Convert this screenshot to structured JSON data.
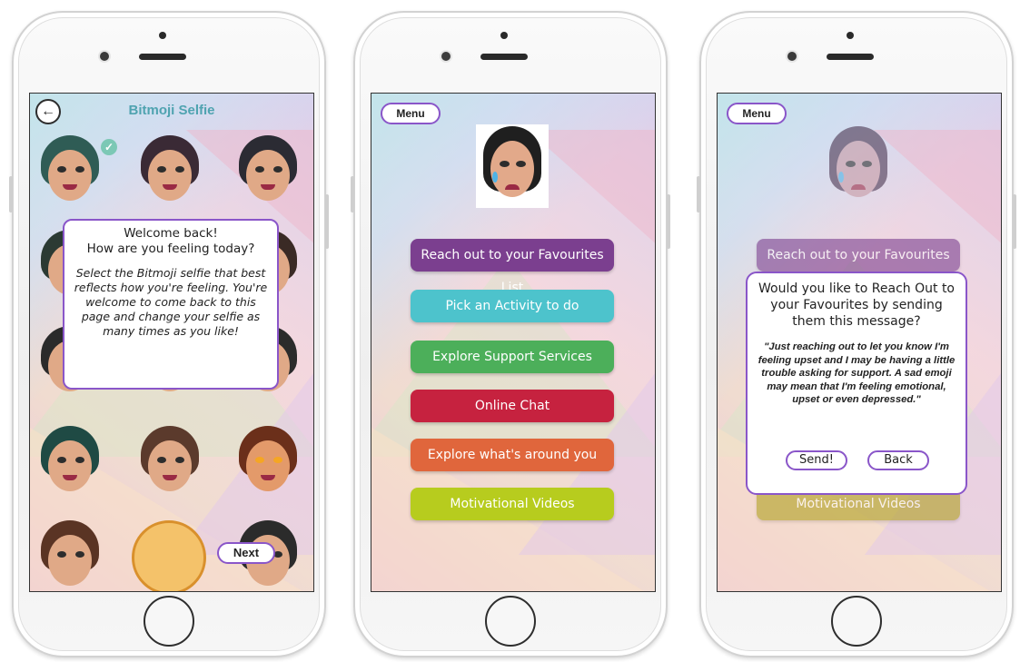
{
  "phone1": {
    "title": "Bitmoji Selfie",
    "back_icon": "←",
    "check_icon": "✓",
    "welcome_heading": "Welcome back!\nHow are you feeling today?",
    "welcome_body": "Select the Bitmoji selfie that best reflects how you're feeling. You're welcome to come back to this page and change your selfie as many times as you like!",
    "next_label": "Next"
  },
  "phone2": {
    "menu_label": "Menu",
    "items": [
      {
        "label": "Reach out to your Favourites List",
        "color": "#7b3f8f"
      },
      {
        "label": "Pick an Activity to do",
        "color": "#4dc3cc"
      },
      {
        "label": "Explore Support Services",
        "color": "#4caf5a"
      },
      {
        "label": "Online Chat",
        "color": "#c6223f"
      },
      {
        "label": "Explore what's around you",
        "color": "#e0663c"
      },
      {
        "label": "Motivational Videos",
        "color": "#b7cc1e"
      }
    ]
  },
  "phone3": {
    "menu_label": "Menu",
    "top_item": "Reach out to your Favourites List",
    "bottom_item": "Motivational Videos",
    "question": "Would you like to Reach Out to your Favourites by sending them this message?",
    "message": "\"Just reaching out to let you know I'm feeling upset and I may be having a little trouble asking for support. A sad emoji may mean that I'm feeling emotional, upset or even depressed.\"",
    "send_label": "Send!",
    "back_label": "Back"
  },
  "colors": {
    "accent": "#8a56c9",
    "title_teal": "#4fa3b0"
  }
}
